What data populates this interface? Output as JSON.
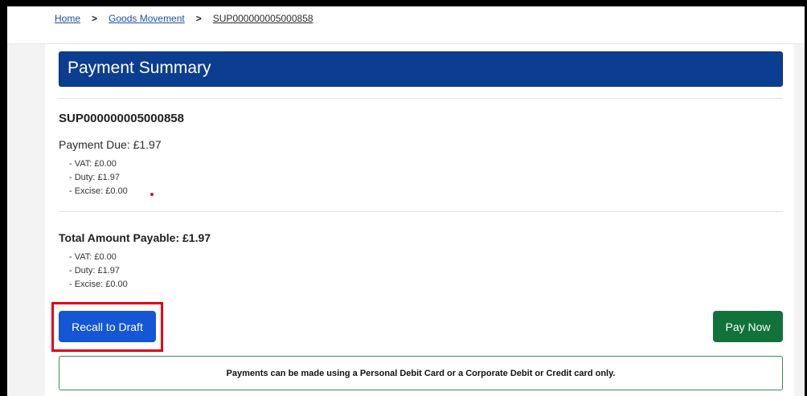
{
  "breadcrumb": {
    "home": "Home",
    "goods_movement": "Goods Movement",
    "current": "SUP000000005000858",
    "separator": ">"
  },
  "summary": {
    "title": "Payment Summary",
    "reference": "SUP000000005000858",
    "payment_due": "Payment Due: £1.97",
    "due_breakdown": [
      "- VAT: £0.00",
      "- Duty: £1.97",
      "- Excise: £0.00"
    ],
    "total_payable": "Total Amount Payable: £1.97",
    "total_breakdown": [
      "- VAT: £0.00",
      "- Duty: £1.97",
      "- Excise: £0.00"
    ]
  },
  "actions": {
    "recall_label": "Recall to Draft",
    "pay_label": "Pay Now"
  },
  "notice": {
    "text": "Payments can be made using a Personal Debit Card or a Corporate Debit or Credit card only."
  },
  "colors": {
    "title_bar": "#0b3d91",
    "recall_button": "#1556d6",
    "pay_button": "#11733a",
    "highlight": "#e0001b",
    "notice_border": "#3f8a55"
  }
}
